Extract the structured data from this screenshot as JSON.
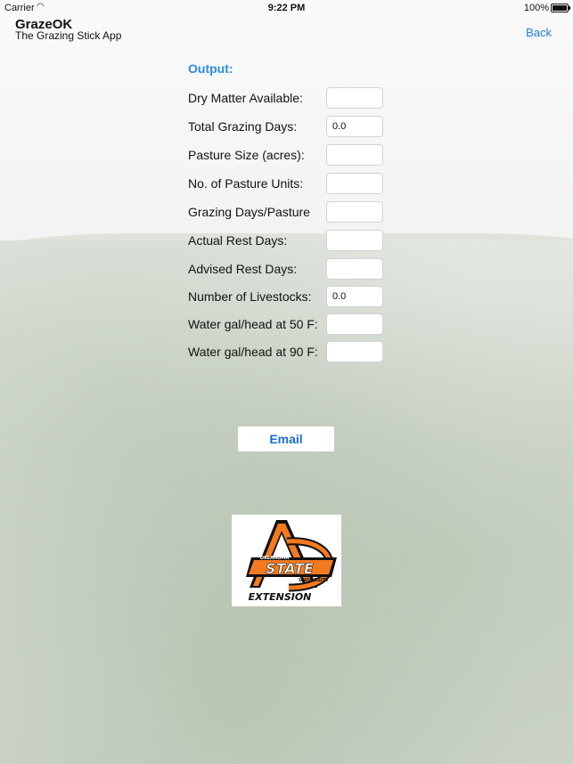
{
  "status_bar": {
    "carrier": "Carrier",
    "time": "9:22 PM",
    "battery": "100%"
  },
  "header": {
    "app_name": "GrazeOK",
    "subtitle": "The Grazing Stick App",
    "back_label": "Back"
  },
  "output": {
    "title": "Output:",
    "rows": [
      {
        "label": "Dry Matter Available:",
        "value": ""
      },
      {
        "label": "Total Grazing Days:",
        "value": "0.0"
      },
      {
        "label": "Pasture Size (acres):",
        "value": ""
      },
      {
        "label": "No. of Pasture Units:",
        "value": ""
      },
      {
        "label": "Grazing Days/Pasture",
        "value": ""
      },
      {
        "label": "Actual Rest Days:",
        "value": ""
      },
      {
        "label": "Advised Rest Days:",
        "value": ""
      },
      {
        "label": "Number of Livestocks:",
        "value": "0.0"
      },
      {
        "label": "Water gal/head at 50 F:",
        "value": ""
      },
      {
        "label": "Water gal/head at 90 F:",
        "value": ""
      }
    ]
  },
  "email_label": "Email",
  "logo": {
    "top_text": "OKLAHOMA",
    "main_text": "STATE",
    "sub_text": "UNIVERSITY",
    "bottom_text": "EXTENSION"
  },
  "colors": {
    "accent": "#1a7fd9",
    "logo_orange": "#f47a20",
    "logo_black": "#111111"
  }
}
